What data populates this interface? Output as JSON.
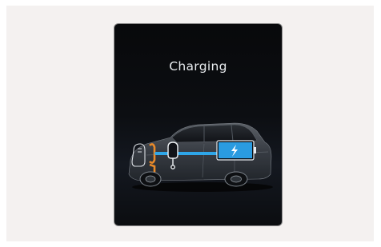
{
  "screen": {
    "title": "Charging"
  },
  "colors": {
    "background": "#f4f1f0",
    "screen": "#0c0e12",
    "charge_flow": "#2ea6e8",
    "battery": "#2a9be0",
    "motor_accent": "#e98a2a"
  },
  "icons": [
    "car-icon",
    "charging-port-icon",
    "battery-icon",
    "lightning-bolt-icon"
  ]
}
